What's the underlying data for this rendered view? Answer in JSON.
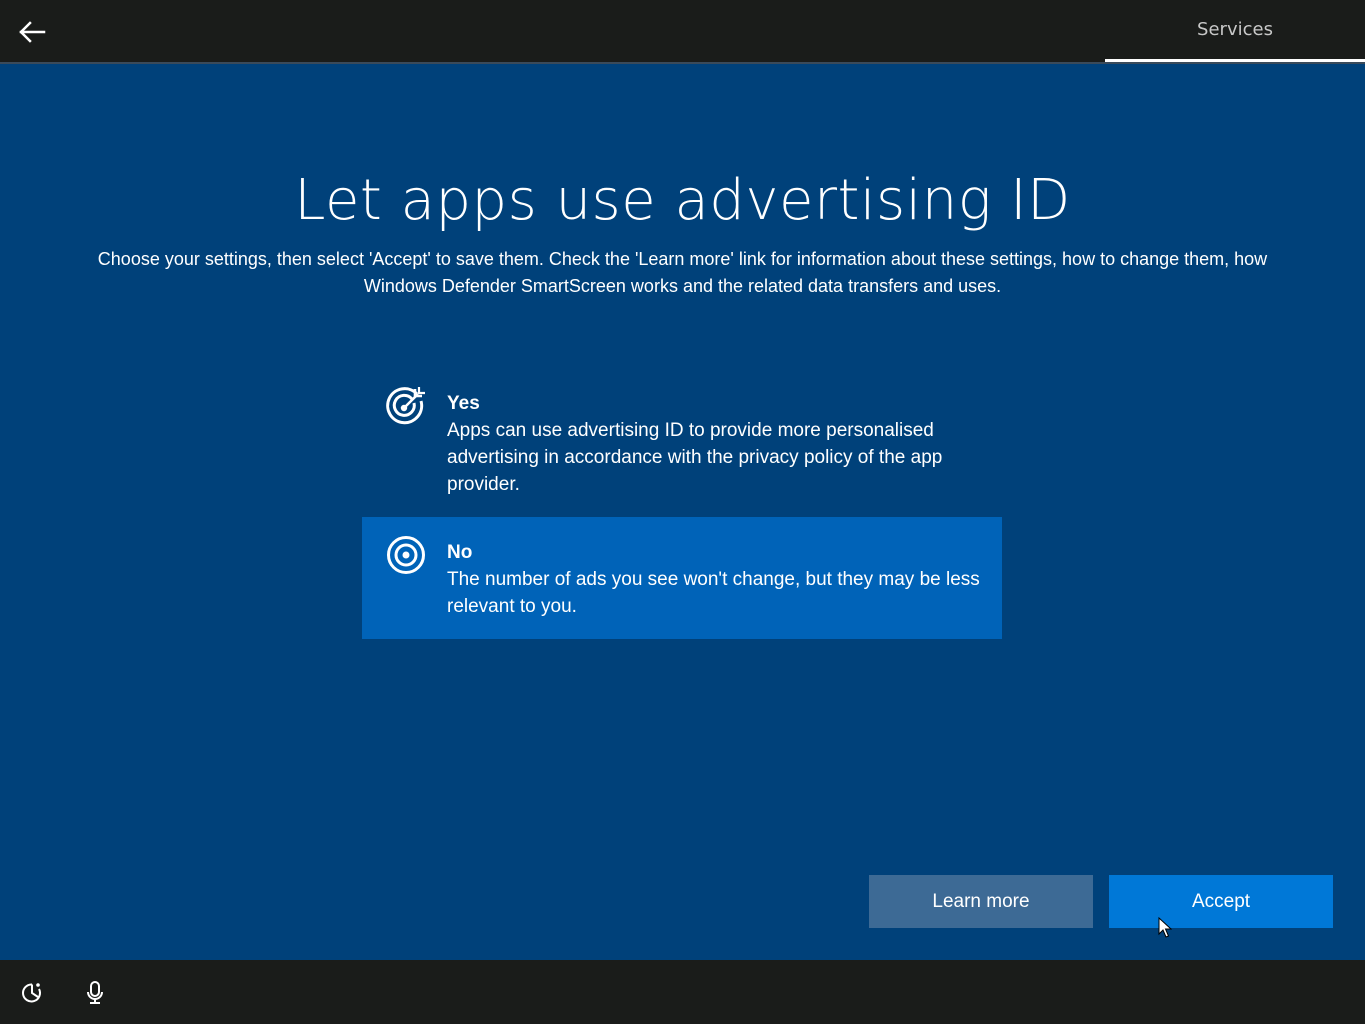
{
  "topbar": {
    "section_label": "Services"
  },
  "main": {
    "title": "Let apps use advertising ID",
    "subtitle": "Choose your settings, then select 'Accept' to save them. Check the 'Learn more' link for information about these settings, how to change them, how Windows Defender SmartScreen works and the related data transfers and uses."
  },
  "options": [
    {
      "title": "Yes",
      "description": "Apps can use advertising ID to provide more personalised advertising in accordance with the privacy policy of the app provider.",
      "icon": "target-arrow-icon",
      "selected": false
    },
    {
      "title": "No",
      "description": "The number of ads you see won't change, but they may be less relevant to you.",
      "icon": "target-icon",
      "selected": true
    }
  ],
  "buttons": {
    "learn_more": "Learn more",
    "accept": "Accept"
  },
  "colors": {
    "background": "#00417a",
    "bar": "#1a1c1a",
    "selected_option": "#0063b8",
    "accept_button": "#0078d7",
    "learn_more_button": "#3d6a95"
  }
}
